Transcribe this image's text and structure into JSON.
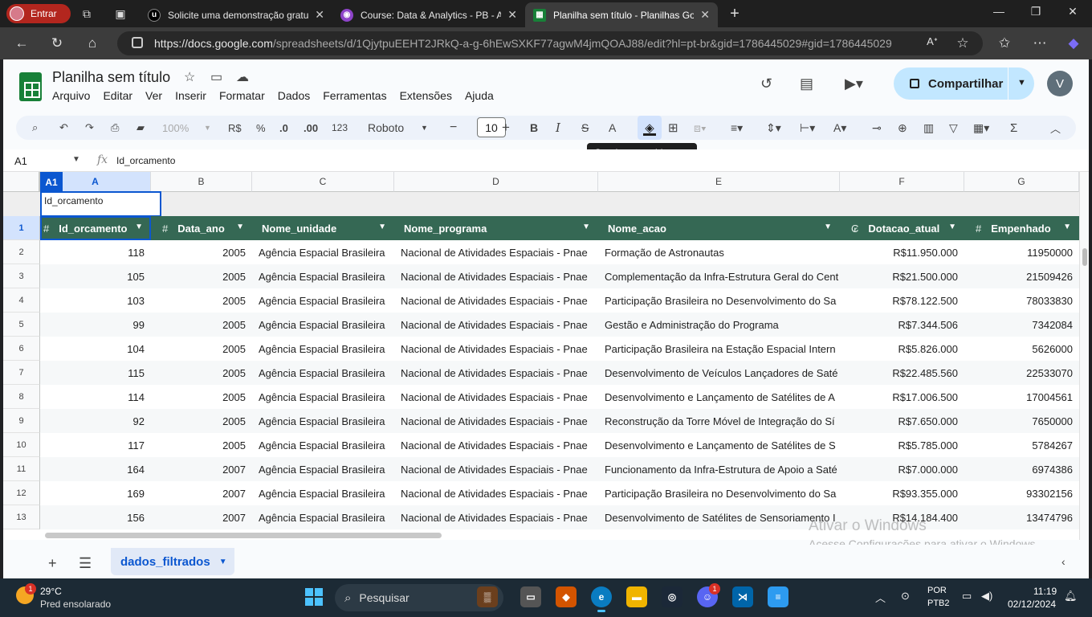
{
  "browser": {
    "profile_label": "Entrar",
    "tabs": [
      {
        "title": "Solicite uma demonstração gratu",
        "favicon": "udemy-icon",
        "active": false
      },
      {
        "title": "Course: Data & Analytics - PB - AW",
        "favicon": "course-icon",
        "active": false
      },
      {
        "title": "Planilha sem título - Planilhas Goo",
        "favicon": "sheets-icon",
        "active": true
      }
    ],
    "url_host": "https://docs.google.com",
    "url_path": "/spreadsheets/d/1QjytpuEEHT2JRkQ-a-g-6hEwSXKF77agwM4jmQOAJ88/edit?hl=pt-br&gid=1786445029#gid=1786445029"
  },
  "doc": {
    "title": "Planilha sem título",
    "menu": [
      "Arquivo",
      "Editar",
      "Ver",
      "Inserir",
      "Formatar",
      "Dados",
      "Ferramentas",
      "Extensões",
      "Ajuda"
    ],
    "share_label": "Compartilhar",
    "user_initial": "V"
  },
  "toolbar": {
    "zoom": "100%",
    "currency": "R$",
    "percent": "%",
    "dec_decrease": ".0",
    "dec_increase": ".00",
    "number_format": "123",
    "font": "Roboto",
    "font_size": "10",
    "bold": "B",
    "italic": "I",
    "strike": "S",
    "text_color": "A",
    "tooltip": "Cor de preenchimento"
  },
  "formula_bar": {
    "name_box": "A1",
    "fx": "fx",
    "value": "Id_orcamento"
  },
  "grid": {
    "column_letters": [
      "A",
      "B",
      "C",
      "D",
      "E",
      "F",
      "G"
    ],
    "selected_chip": "A1",
    "selected_cell_value": "Id_orcamento",
    "header_row_number": "1",
    "headers": [
      {
        "label": "Id_orcamento",
        "type": "#"
      },
      {
        "label": "Data_ano",
        "type": "#"
      },
      {
        "label": "Nome_unidade",
        "type": ""
      },
      {
        "label": "Nome_programa",
        "type": ""
      },
      {
        "label": "Nome_acao",
        "type": ""
      },
      {
        "label": "Dotacao_atual",
        "type": "₢"
      },
      {
        "label": "Empenhado",
        "type": "#"
      }
    ],
    "rows": [
      {
        "n": "2",
        "c": [
          "118",
          "2005",
          "Agência Espacial Brasileira",
          "Nacional de Atividades Espaciais - Pnae",
          "Formação de Astronautas",
          "R$11.950.000",
          "11950000"
        ]
      },
      {
        "n": "3",
        "c": [
          "105",
          "2005",
          "Agência Espacial Brasileira",
          "Nacional de Atividades Espaciais - Pnae",
          "Complementação da Infra-Estrutura Geral do Cent",
          "R$21.500.000",
          "21509426"
        ]
      },
      {
        "n": "4",
        "c": [
          "103",
          "2005",
          "Agência Espacial Brasileira",
          "Nacional de Atividades Espaciais - Pnae",
          "Participação Brasileira no Desenvolvimento do Sa",
          "R$78.122.500",
          "78033830"
        ]
      },
      {
        "n": "5",
        "c": [
          "99",
          "2005",
          "Agência Espacial Brasileira",
          "Nacional de Atividades Espaciais - Pnae",
          "Gestão e Administração do Programa",
          "R$7.344.506",
          "7342084"
        ]
      },
      {
        "n": "6",
        "c": [
          "104",
          "2005",
          "Agência Espacial Brasileira",
          "Nacional de Atividades Espaciais - Pnae",
          "Participação Brasileira na Estação Espacial Intern",
          "R$5.826.000",
          "5626000"
        ]
      },
      {
        "n": "7",
        "c": [
          "115",
          "2005",
          "Agência Espacial Brasileira",
          "Nacional de Atividades Espaciais - Pnae",
          "Desenvolvimento de Veículos Lançadores de Saté",
          "R$22.485.560",
          "22533070"
        ]
      },
      {
        "n": "8",
        "c": [
          "114",
          "2005",
          "Agência Espacial Brasileira",
          "Nacional de Atividades Espaciais - Pnae",
          "Desenvolvimento e Lançamento de Satélites de A",
          "R$17.006.500",
          "17004561"
        ]
      },
      {
        "n": "9",
        "c": [
          "92",
          "2005",
          "Agência Espacial Brasileira",
          "Nacional de Atividades Espaciais - Pnae",
          "Reconstrução da Torre Móvel de Integração do Sí",
          "R$7.650.000",
          "7650000"
        ]
      },
      {
        "n": "10",
        "c": [
          "117",
          "2005",
          "Agência Espacial Brasileira",
          "Nacional de Atividades Espaciais - Pnae",
          "Desenvolvimento e Lançamento de Satélites de S",
          "R$5.785.000",
          "5784267"
        ]
      },
      {
        "n": "11",
        "c": [
          "164",
          "2007",
          "Agência Espacial Brasileira",
          "Nacional de Atividades Espaciais - Pnae",
          "Funcionamento da Infra-Estrutura de Apoio a Saté",
          "R$7.000.000",
          "6974386"
        ]
      },
      {
        "n": "12",
        "c": [
          "169",
          "2007",
          "Agência Espacial Brasileira",
          "Nacional de Atividades Espaciais - Pnae",
          "Participação Brasileira no Desenvolvimento do Sa",
          "R$93.355.000",
          "93302156"
        ]
      },
      {
        "n": "13",
        "c": [
          "156",
          "2007",
          "Agência Espacial Brasileira",
          "Nacional de Atividades Espaciais - Pnae",
          "Desenvolvimento de Satélites de Sensoriamento I",
          "R$14.184.400",
          "13474796"
        ]
      }
    ]
  },
  "watermark": {
    "line1": "Ativar o Windows",
    "line2": "Acesse Configurações para ativar o Windows."
  },
  "sheet_tab": "dados_filtrados",
  "taskbar": {
    "temperature": "29°C",
    "weather": "Pred ensolarado",
    "weather_badge": "1",
    "search": "Pesquisar",
    "discord_badge": "1",
    "lang1": "POR",
    "lang2": "PTB2",
    "time": "11:19",
    "date": "02/12/2024"
  }
}
